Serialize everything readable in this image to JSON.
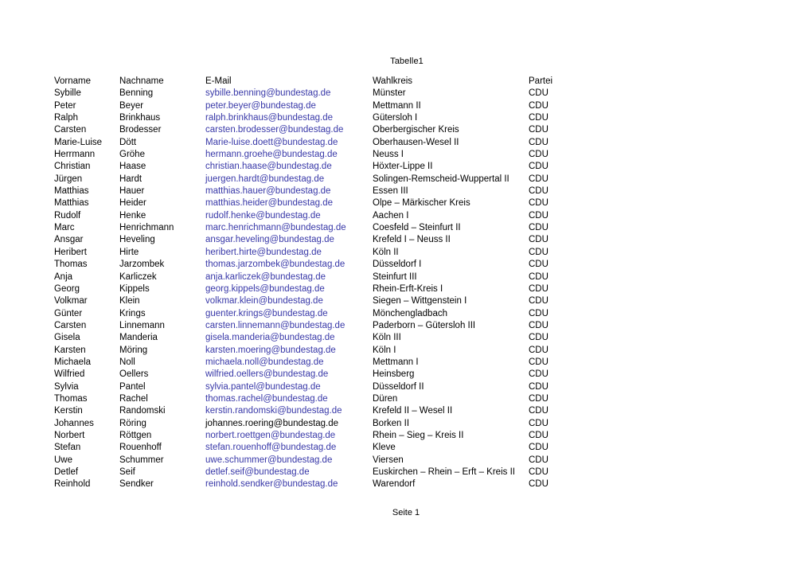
{
  "document": {
    "header_title": "Tabelle1",
    "footer_text": "Seite 1"
  },
  "colors": {
    "link": "#3838a8",
    "text": "#000000",
    "background": "#ffffff"
  },
  "table": {
    "columns": [
      {
        "key": "vorname",
        "label": "Vorname"
      },
      {
        "key": "nachname",
        "label": "Nachname"
      },
      {
        "key": "email",
        "label": "E-Mail"
      },
      {
        "key": "wahlkreis",
        "label": "Wahlkreis"
      },
      {
        "key": "partei",
        "label": "Partei"
      }
    ],
    "rows": [
      {
        "vorname": "Sybille",
        "nachname": "Benning",
        "email": "sybille.benning@bundestag.de",
        "email_is_link": true,
        "wahlkreis": "Münster",
        "partei": "CDU"
      },
      {
        "vorname": "Peter",
        "nachname": "Beyer",
        "email": "peter.beyer@bundestag.de",
        "email_is_link": true,
        "wahlkreis": "Mettmann II",
        "partei": "CDU"
      },
      {
        "vorname": "Ralph",
        "nachname": "Brinkhaus",
        "email": "ralph.brinkhaus@bundestag.de",
        "email_is_link": true,
        "wahlkreis": "Gütersloh I",
        "partei": "CDU"
      },
      {
        "vorname": "Carsten",
        "nachname": "Brodesser",
        "email": "carsten.brodesser@bundestag.de",
        "email_is_link": true,
        "wahlkreis": "Oberbergischer Kreis",
        "partei": "CDU"
      },
      {
        "vorname": "Marie-Luise",
        "nachname": "Dött",
        "email": "Marie-luise.doett@bundestag.de",
        "email_is_link": true,
        "wahlkreis": "Oberhausen-Wesel II",
        "partei": "CDU"
      },
      {
        "vorname": "Herrmann",
        "nachname": "Gröhe",
        "email": "hermann.groehe@bundestag.de",
        "email_is_link": true,
        "wahlkreis": "Neuss I",
        "partei": "CDU"
      },
      {
        "vorname": "Christian",
        "nachname": "Haase",
        "email": "christian.haase@bundestag.de",
        "email_is_link": true,
        "wahlkreis": "Höxter-Lippe II",
        "partei": "CDU"
      },
      {
        "vorname": "Jürgen",
        "nachname": "Hardt",
        "email": "juergen.hardt@bundestag.de",
        "email_is_link": true,
        "wahlkreis": "Solingen-Remscheid-Wuppertal II",
        "partei": "CDU"
      },
      {
        "vorname": "Matthias",
        "nachname": "Hauer",
        "email": "matthias.hauer@bundestag.de",
        "email_is_link": true,
        "wahlkreis": "Essen III",
        "partei": "CDU"
      },
      {
        "vorname": "Matthias",
        "nachname": "Heider",
        "email": "matthias.heider@bundestag.de",
        "email_is_link": true,
        "wahlkreis": "Olpe – Märkischer Kreis",
        "partei": "CDU"
      },
      {
        "vorname": "Rudolf",
        "nachname": "Henke",
        "email": "rudolf.henke@bundestag.de",
        "email_is_link": true,
        "wahlkreis": "Aachen I",
        "partei": "CDU"
      },
      {
        "vorname": "Marc",
        "nachname": "Henrichmann",
        "email": "marc.henrichmann@bundestag.de",
        "email_is_link": true,
        "wahlkreis": "Coesfeld – Steinfurt II",
        "partei": "CDU"
      },
      {
        "vorname": "Ansgar",
        "nachname": "Heveling",
        "email": "ansgar.heveling@bundestag.de",
        "email_is_link": true,
        "wahlkreis": "Krefeld I – Neuss II",
        "partei": "CDU"
      },
      {
        "vorname": "Heribert",
        "nachname": "Hirte",
        "email": "heribert.hirte@bundestag.de",
        "email_is_link": true,
        "wahlkreis": "Köln II",
        "partei": "CDU"
      },
      {
        "vorname": "Thomas",
        "nachname": "Jarzombek",
        "email": "thomas.jarzombek@bundestag.de",
        "email_is_link": true,
        "wahlkreis": "Düsseldorf I",
        "partei": "CDU"
      },
      {
        "vorname": "Anja",
        "nachname": "Karliczek",
        "email": "anja.karliczek@bundestag.de",
        "email_is_link": true,
        "wahlkreis": "Steinfurt III",
        "partei": "CDU"
      },
      {
        "vorname": "Georg",
        "nachname": "Kippels",
        "email": "georg.kippels@bundestag.de",
        "email_is_link": true,
        "wahlkreis": "Rhein-Erft-Kreis I",
        "partei": "CDU"
      },
      {
        "vorname": "Volkmar",
        "nachname": "Klein",
        "email": "volkmar.klein@bundestag.de",
        "email_is_link": true,
        "wahlkreis": "Siegen – Wittgenstein I",
        "partei": "CDU"
      },
      {
        "vorname": "Günter",
        "nachname": "Krings",
        "email": "guenter.krings@bundestag.de",
        "email_is_link": true,
        "wahlkreis": "Mönchengladbach",
        "partei": "CDU"
      },
      {
        "vorname": "Carsten",
        "nachname": "Linnemann",
        "email": "carsten.linnemann@bundestag.de",
        "email_is_link": true,
        "wahlkreis": "Paderborn – Gütersloh III",
        "partei": "CDU"
      },
      {
        "vorname": "Gisela",
        "nachname": "Manderia",
        "email": "gisela.manderia@bundestag.de",
        "email_is_link": true,
        "wahlkreis": "Köln III",
        "partei": "CDU"
      },
      {
        "vorname": "Karsten",
        "nachname": "Möring",
        "email": "karsten.moering@bundestag.de",
        "email_is_link": true,
        "wahlkreis": "Köln I",
        "partei": "CDU"
      },
      {
        "vorname": "Michaela",
        "nachname": "Noll",
        "email": "michaela.noll@bundestag.de",
        "email_is_link": true,
        "wahlkreis": "Mettmann I",
        "partei": "CDU"
      },
      {
        "vorname": "Wilfried",
        "nachname": "Oellers",
        "email": "wilfried.oellers@bundestag.de",
        "email_is_link": true,
        "wahlkreis": "Heinsberg",
        "partei": "CDU"
      },
      {
        "vorname": "Sylvia",
        "nachname": "Pantel",
        "email": "sylvia.pantel@bundestag.de",
        "email_is_link": true,
        "wahlkreis": "Düsseldorf II",
        "partei": "CDU"
      },
      {
        "vorname": "Thomas",
        "nachname": "Rachel",
        "email": "thomas.rachel@bundestag.de",
        "email_is_link": true,
        "wahlkreis": "Düren",
        "partei": "CDU"
      },
      {
        "vorname": "Kerstin",
        "nachname": "Randomski",
        "email": "kerstin.randomski@bundestag.de",
        "email_is_link": true,
        "wahlkreis": "Krefeld II – Wesel II",
        "partei": "CDU"
      },
      {
        "vorname": "Johannes",
        "nachname": "Röring",
        "email": "johannes.roering@bundestag.de",
        "email_is_link": false,
        "wahlkreis": "Borken II",
        "partei": "CDU"
      },
      {
        "vorname": "Norbert",
        "nachname": "Röttgen",
        "email": "norbert.roettgen@bundestag.de",
        "email_is_link": true,
        "wahlkreis": "Rhein – Sieg – Kreis II",
        "partei": "CDU"
      },
      {
        "vorname": "Stefan",
        "nachname": "Rouenhoff",
        "email": "stefan.rouenhoff@bundestag.de",
        "email_is_link": true,
        "wahlkreis": "Kleve",
        "partei": "CDU"
      },
      {
        "vorname": "Uwe",
        "nachname": "Schummer",
        "email": "uwe.schummer@bundestag.de",
        "email_is_link": true,
        "wahlkreis": "Viersen",
        "partei": "CDU"
      },
      {
        "vorname": "Detlef",
        "nachname": "Seif",
        "email": "detlef.seif@bundestag.de",
        "email_is_link": true,
        "wahlkreis": "Euskirchen – Rhein – Erft – Kreis II",
        "partei": "CDU"
      },
      {
        "vorname": "Reinhold",
        "nachname": "Sendker",
        "email": "reinhold.sendker@bundestag.de",
        "email_is_link": true,
        "wahlkreis": "Warendorf",
        "partei": "CDU"
      }
    ]
  }
}
